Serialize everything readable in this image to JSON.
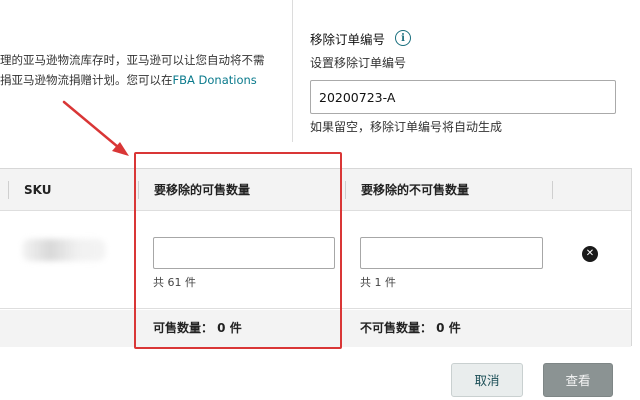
{
  "info": {
    "line1": "理的亚马逊物流库存时，亚马逊可以让您自动将不需",
    "line2_prefix": "捐亚马逊物流捐赠计划。您可以在",
    "line2_link": "FBA Donations"
  },
  "order": {
    "title": "移除订单编号",
    "subtitle": "设置移除订单编号",
    "value": "20200723-A",
    "hint": "如果留空，移除订单编号将自动生成"
  },
  "table": {
    "headers": {
      "sku": "SKU",
      "sellable_remove": "要移除的可售数量",
      "unsellable_remove": "要移除的不可售数量"
    },
    "row": {
      "sellable_total": "共 61 件",
      "unsellable_total": "共 1 件",
      "remove_icon": "x-circle-icon"
    },
    "footer": {
      "sellable_count": "可售数量： 0 件",
      "unsellable_count": "不可售数量： 0 件"
    }
  },
  "buttons": {
    "cancel": "取消",
    "view": "查看"
  },
  "colors": {
    "annotation": "#d93636",
    "accent": "#1a6f7e",
    "link": "#0a7a8c"
  }
}
